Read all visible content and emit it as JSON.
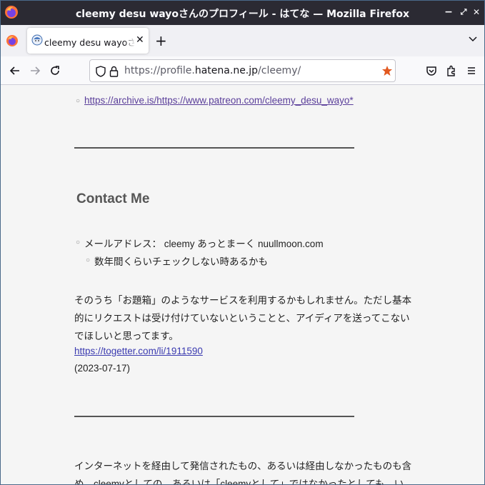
{
  "window": {
    "title": "cleemy desu wayoさんのプロフィール - はてな — Mozilla Firefox",
    "controls": {
      "minimize": "−",
      "maximize": "⤢",
      "close": "✕"
    }
  },
  "tab": {
    "label": "cleemy desu wayoさんのプロフィール - はてな",
    "close": "✕"
  },
  "newtab": "+",
  "urlbar": {
    "prefix": "https://profile.",
    "host": "hatena.ne.jp",
    "path": "/cleemy/"
  },
  "content": {
    "top_link": "https://archive.is/https://www.patreon.com/cleemy_desu_wayo*",
    "heading": "Contact Me",
    "email_item": "メールアドレス： cleemy あっとまーく nuullmoon.com",
    "sub_item": "数年間くらいチェックしない時あるかも",
    "para1_line1": "そのうち「お題箱」のようなサービスを利用するかもしれません。ただし基本",
    "para1_line2": "的にリクエストは受け付けていないということと、アイディアを送ってこない",
    "para1_line3": "でほしいと思ってます。",
    "para1_link": "https://togetter.com/li/1911590",
    "para1_date": "(2023-07-17)",
    "para2_line1": "インターネットを経由して発信されたもの、あるいは経由しなかったものも含",
    "para2_line2": "め、cleemyとしての、あるいは「cleemyとして」ではなかったとしても、い"
  },
  "colors": {
    "titlebar": "#2b2a33",
    "accent_star": "#e25920",
    "link_visited": "#5a3e9a",
    "link": "#3a3ab0"
  }
}
